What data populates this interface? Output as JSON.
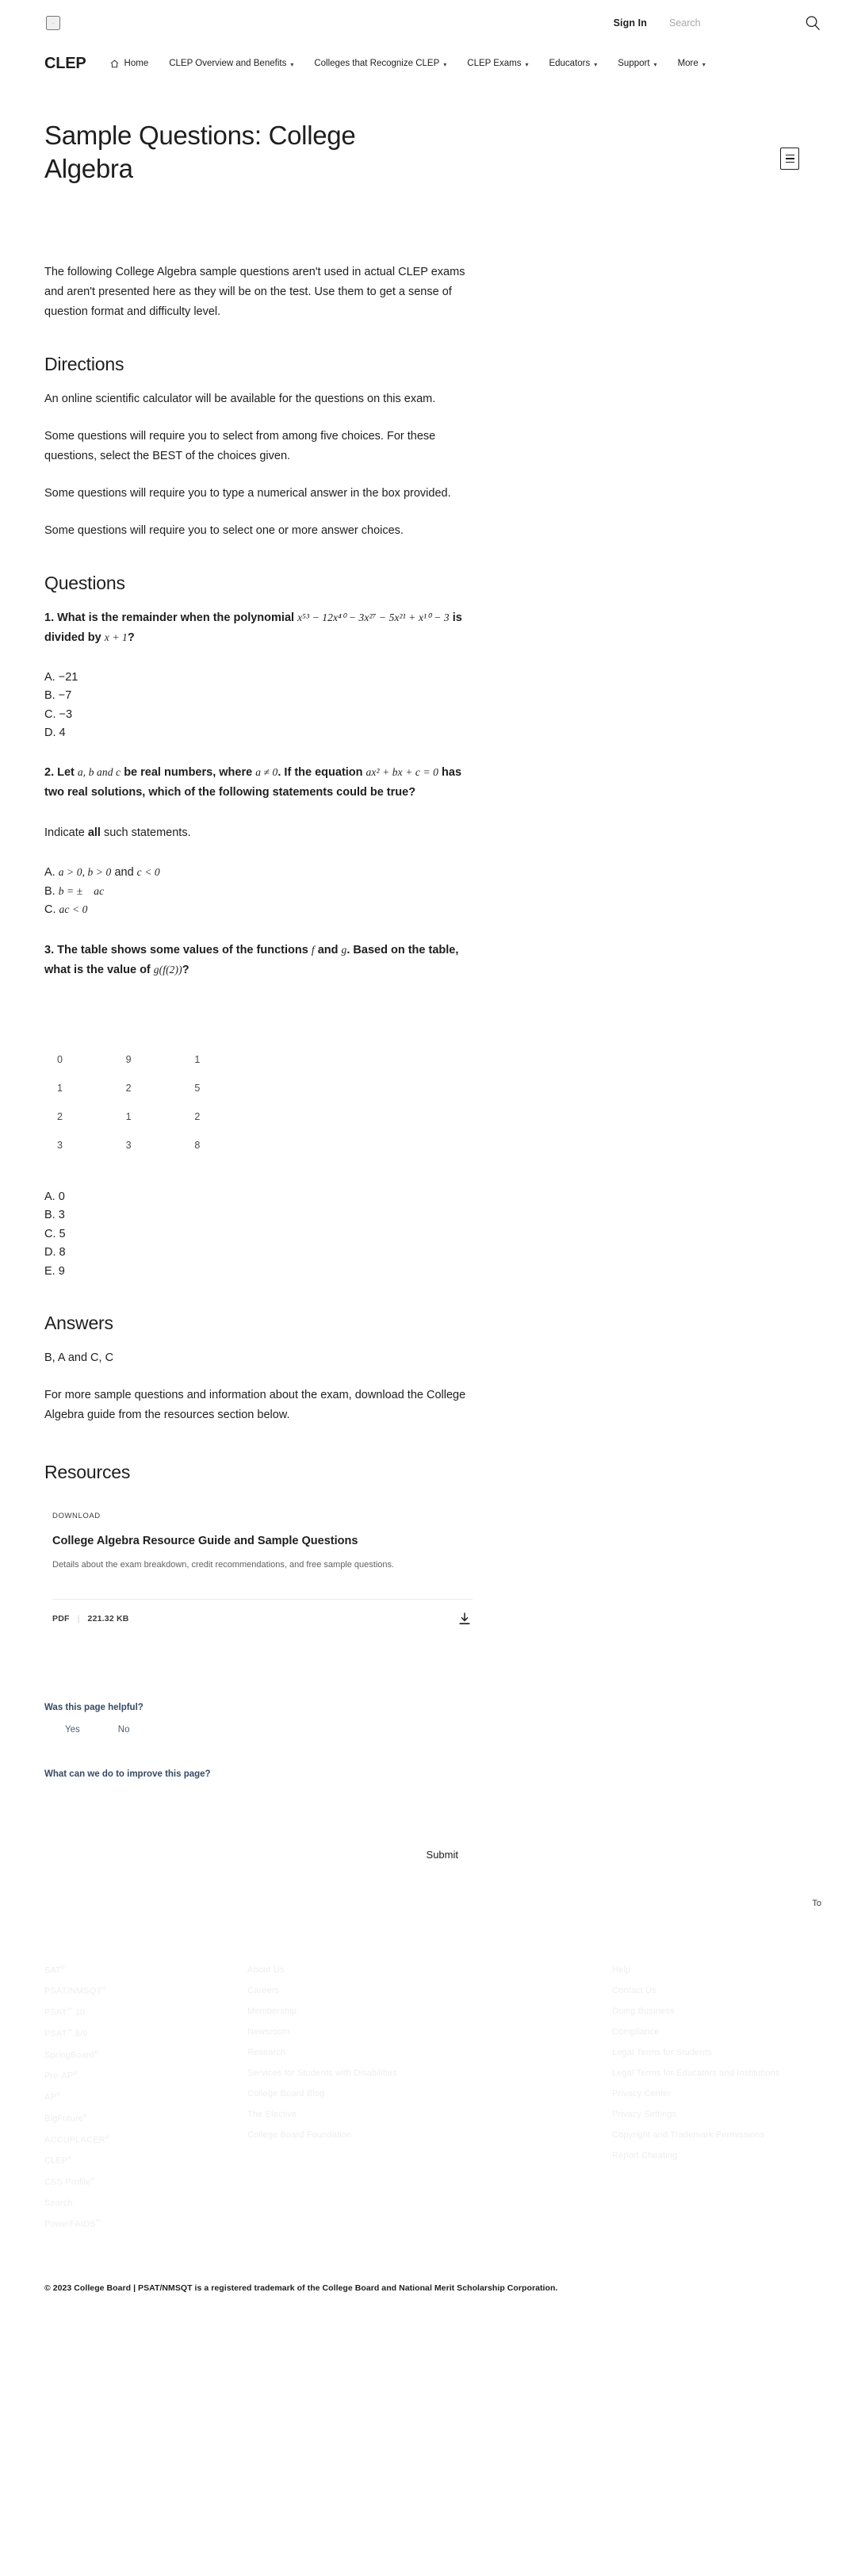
{
  "utility": {
    "language_toggle_icon": "chevron-down-icon",
    "sign_in": "Sign In",
    "search_placeholder": "Search",
    "search_value": "",
    "search_icon": "search-icon"
  },
  "nav": {
    "brand": "CLEP",
    "items": [
      {
        "label": "Home",
        "icon": "home-icon",
        "caret": false
      },
      {
        "label": "CLEP Overview and Benefits",
        "caret": true
      },
      {
        "label": "Colleges that Recognize CLEP",
        "caret": true
      },
      {
        "label": "CLEP Exams",
        "caret": true
      },
      {
        "label": "Educators",
        "caret": true
      },
      {
        "label": "Support",
        "caret": true
      },
      {
        "label": "More",
        "caret": true
      }
    ]
  },
  "page": {
    "title": "Sample Questions: College Algebra",
    "toc_icon": "table-of-contents-icon",
    "intro": "The following College Algebra sample questions aren't used in actual CLEP exams and aren't presented here as they will be on the test. Use them to get a sense of question format and difficulty level."
  },
  "directions": {
    "heading": "Directions",
    "paragraphs": [
      "An online scientific calculator will be available for the questions on this exam.",
      "Some questions will require you to select from among five choices. For these questions, select the BEST of the choices given.",
      "Some questions will require you to type a numerical answer in the box provided.",
      "Some questions will require you to select one or more answer choices."
    ]
  },
  "questions": {
    "heading": "Questions",
    "q1": {
      "number": "1.",
      "stem_part1": "What is the remainder when the polynomial",
      "polynomial": "x⁵³ − 12x⁴⁰ − 3x²⁷ − 5x²¹ + x¹⁰ − 3",
      "stem_part2": "is divided by",
      "divisor": "x + 1",
      "stem_end": "?",
      "choices": [
        "A. −21",
        "B. −7",
        "C. −3",
        "D. 4"
      ]
    },
    "q2": {
      "number": "2.",
      "stem_part1": "Let",
      "vars": "a, b and c",
      "stem_part2": "be real numbers, where",
      "condition": "a ≠ 0",
      "stem_part3": ". If the equation",
      "equation": "ax² + bx + c = 0",
      "stem_part4": "has two real solutions, which of the following statements could be true?",
      "indicate_prefix": "Indicate",
      "indicate_bold": "all",
      "indicate_suffix": "such statements.",
      "choices": [
        {
          "letter": "A.",
          "math_a": "a > 0, b > 0",
          "plain": "and",
          "math_b": "c < 0"
        },
        {
          "letter": "B.",
          "math_a": "b = ±",
          "plain": "",
          "math_b": "ac"
        },
        {
          "letter": "C.",
          "math_a": "ac < 0",
          "plain": "",
          "math_b": ""
        }
      ]
    },
    "q3": {
      "number": "3.",
      "stem_part1": "The table shows some values of the functions",
      "fn_f": "f",
      "stem_part2": "and",
      "fn_g": "g",
      "stem_part3": ". Based on the table, what is the value of",
      "expression": "g(f(2))",
      "stem_end": "?",
      "choices": [
        "A. 0",
        "B. 3",
        "C. 5",
        "D. 8",
        "E. 9"
      ]
    }
  },
  "chart_data": {
    "type": "table",
    "title": "",
    "columns": [
      "",
      "",
      ""
    ],
    "rows": [
      [
        "0",
        "9",
        "1"
      ],
      [
        "1",
        "2",
        "5"
      ],
      [
        "2",
        "1",
        "2"
      ],
      [
        "3",
        "3",
        "8"
      ]
    ]
  },
  "answers": {
    "heading": "Answers",
    "value": "B, A and C, C",
    "more_info": "For more sample questions and information about the exam, download the College Algebra guide from the resources section below."
  },
  "resources": {
    "heading": "Resources",
    "card": {
      "eyebrow": "DOWNLOAD",
      "title": "College Algebra Resource Guide and Sample Questions",
      "description": "Details about the exam breakdown, credit recommendations, and free sample questions.",
      "file_type": "PDF",
      "separator": "|",
      "file_size": "221.32 KB",
      "download_icon": "download-icon"
    }
  },
  "feedback": {
    "question": "Was this page helpful?",
    "yes": "Yes",
    "no": "No",
    "improve_question": "What can we do to improve this page?",
    "improve_value": "",
    "improve_placeholder": "",
    "submit": "Submit"
  },
  "back_to_top": "To",
  "footer": {
    "col1": [
      {
        "label": "SAT",
        "sup": "®"
      },
      {
        "label": "PSAT/NMSQT",
        "sup": "®"
      },
      {
        "label": "PSAT",
        "sup": "™",
        "suffix": " 10"
      },
      {
        "label": "PSAT",
        "sup": "™",
        "suffix": " 8/9"
      },
      {
        "label": "SpringBoard",
        "sup": "®"
      },
      {
        "label": "Pre-AP",
        "sup": "®"
      },
      {
        "label": "AP",
        "sup": "®"
      },
      {
        "label": "BigFuture",
        "sup": "®"
      },
      {
        "label": "ACCUPLACER",
        "sup": "®"
      },
      {
        "label": "CLEP",
        "sup": "®"
      },
      {
        "label": "CSS Profile",
        "sup": "®"
      },
      {
        "label": "Search",
        "sup": ""
      },
      {
        "label": "PowerFAIDS",
        "sup": "™"
      }
    ],
    "col2": [
      {
        "label": "About Us"
      },
      {
        "label": "Careers"
      },
      {
        "label": "Membership"
      },
      {
        "label": "Newsroom"
      },
      {
        "label": "Research"
      },
      {
        "label": "Services for Students with Disabilities"
      },
      {
        "label": "College Board Blog"
      },
      {
        "label": "The Elective"
      },
      {
        "label": "College Board Foundation"
      }
    ],
    "col3": [
      {
        "label": "Help"
      },
      {
        "label": "Contact Us"
      },
      {
        "label": "Doing Business"
      },
      {
        "label": "Compliance"
      },
      {
        "label": "Legal Terms for Students"
      },
      {
        "label": "Legal Terms for Educators and Institutions"
      },
      {
        "label": "Privacy Center"
      },
      {
        "label": "Privacy Settings"
      },
      {
        "label": "Copyright and Trademark Permissions"
      },
      {
        "label": "Report Cheating"
      }
    ],
    "copyright": "© 2023 College Board | PSAT/NMSQT is a registered trademark of the College Board and National Merit Scholarship Corporation."
  }
}
